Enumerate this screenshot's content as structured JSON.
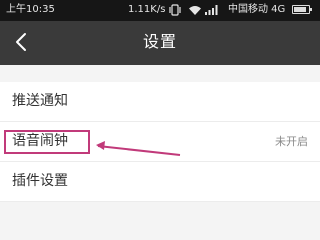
{
  "status_bar": {
    "time": "上午10:35",
    "speed": "1.11K/s",
    "carrier": "中国移动 4G",
    "battery_level": 0.85,
    "icons": [
      "vibrate-icon",
      "wifi-icon",
      "signal-icon",
      "battery-icon"
    ]
  },
  "header": {
    "title": "设置",
    "back_icon": "back-arrow-icon"
  },
  "settings": {
    "items": [
      {
        "label": "推送通知",
        "value": ""
      },
      {
        "label": "语音闹钟",
        "value": "未开启",
        "highlighted": true
      },
      {
        "label": "插件设置",
        "value": ""
      }
    ]
  },
  "colors": {
    "status_bar": "#161616",
    "title_bar": "#3a3a3a",
    "highlight": "#c13a7a",
    "background": "#f4f4f4"
  }
}
